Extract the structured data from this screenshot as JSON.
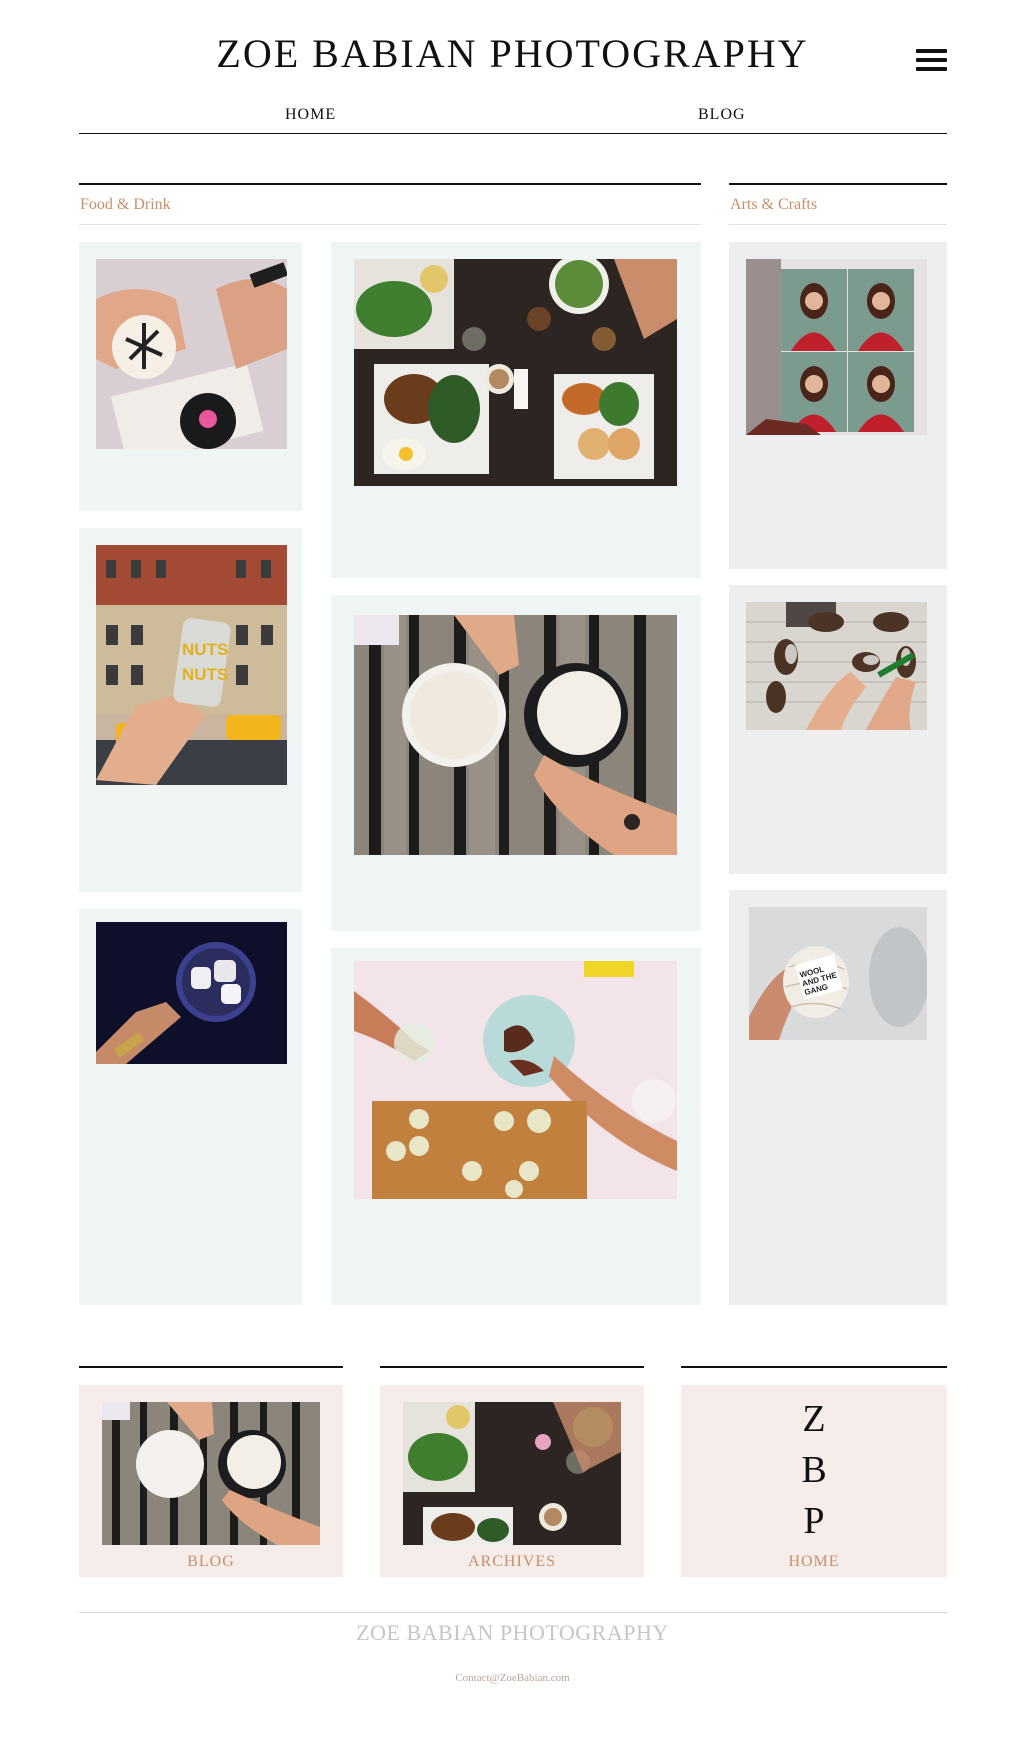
{
  "header": {
    "site_title": "ZOE BABIAN PHOTOGRAPHY",
    "menu_icon": "hamburger-menu-icon",
    "nav": [
      {
        "label": "HOME"
      },
      {
        "label": "BLOG"
      }
    ]
  },
  "sections": {
    "food": {
      "title": "Food & Drink"
    },
    "arts": {
      "title": "Arts & Crafts"
    }
  },
  "footer_cards": [
    {
      "label": "BLOG"
    },
    {
      "label": "ARCHIVES"
    },
    {
      "label": "HOME",
      "monogram": [
        "Z",
        "B",
        "P"
      ]
    }
  ],
  "footer": {
    "title": "ZOE BABIAN PHOTOGRAPHY",
    "contact": "Contact@ZoeBabian.com"
  },
  "colors": {
    "accent": "#c98f6a",
    "card_mint": "#eef5f4",
    "card_grey": "#efeeef",
    "card_pink": "#f6ecea"
  }
}
